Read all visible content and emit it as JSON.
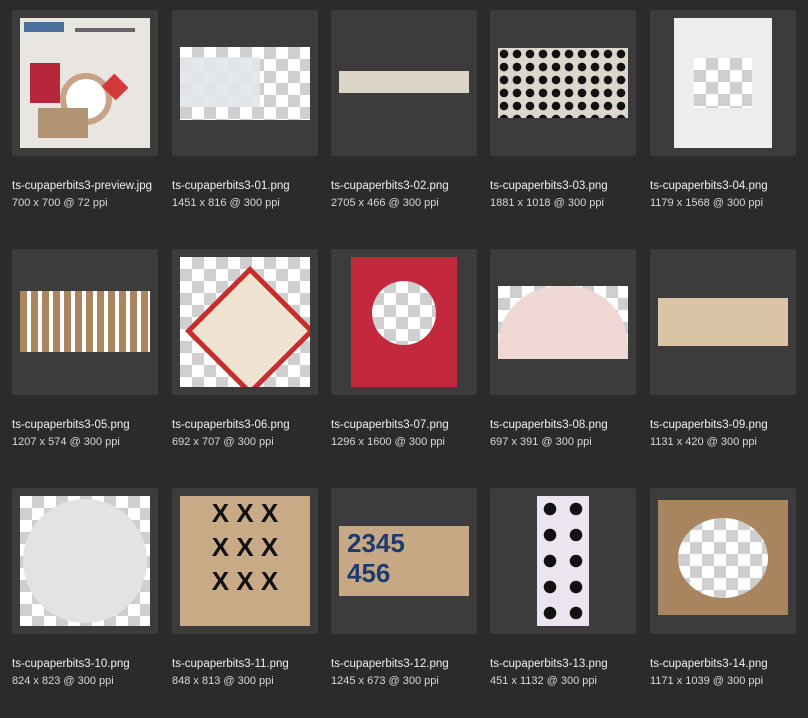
{
  "files": [
    {
      "name": "ts-cupaperbits3-preview.jpg",
      "meta": "700 x 700 @ 72 ppi"
    },
    {
      "name": "ts-cupaperbits3-01.png",
      "meta": "1451 x 816 @ 300 ppi"
    },
    {
      "name": "ts-cupaperbits3-02.png",
      "meta": "2705 x 466 @ 300 ppi"
    },
    {
      "name": "ts-cupaperbits3-03.png",
      "meta": "1881 x 1018 @ 300 ppi"
    },
    {
      "name": "ts-cupaperbits3-04.png",
      "meta": "1179 x 1568 @ 300 ppi"
    },
    {
      "name": "ts-cupaperbits3-05.png",
      "meta": "1207 x 574 @ 300 ppi"
    },
    {
      "name": "ts-cupaperbits3-06.png",
      "meta": "692 x 707 @ 300 ppi"
    },
    {
      "name": "ts-cupaperbits3-07.png",
      "meta": "1296 x 1600 @ 300 ppi"
    },
    {
      "name": "ts-cupaperbits3-08.png",
      "meta": "697 x 391 @ 300 ppi"
    },
    {
      "name": "ts-cupaperbits3-09.png",
      "meta": "1131 x 420 @ 300 ppi"
    },
    {
      "name": "ts-cupaperbits3-10.png",
      "meta": "824 x 823 @ 300 ppi"
    },
    {
      "name": "ts-cupaperbits3-11.png",
      "meta": "848 x 813 @ 300 ppi"
    },
    {
      "name": "ts-cupaperbits3-12.png",
      "meta": "1245 x 673 @ 300 ppi"
    },
    {
      "name": "ts-cupaperbits3-13.png",
      "meta": "451 x 1132 @ 300 ppi"
    },
    {
      "name": "ts-cupaperbits3-14.png",
      "meta": "1171 x 1039 @ 300 ppi"
    }
  ],
  "thumbnails": {
    "preview_kit_text": "ts-cupaperbits3",
    "item12_digits": "2345\n456"
  },
  "colors": {
    "background": "#2b2b2b",
    "thumb_tile": "#3c3c3c",
    "kraft": "#b4916b",
    "red": "#c4283d",
    "ink": "#1e1e1e"
  }
}
